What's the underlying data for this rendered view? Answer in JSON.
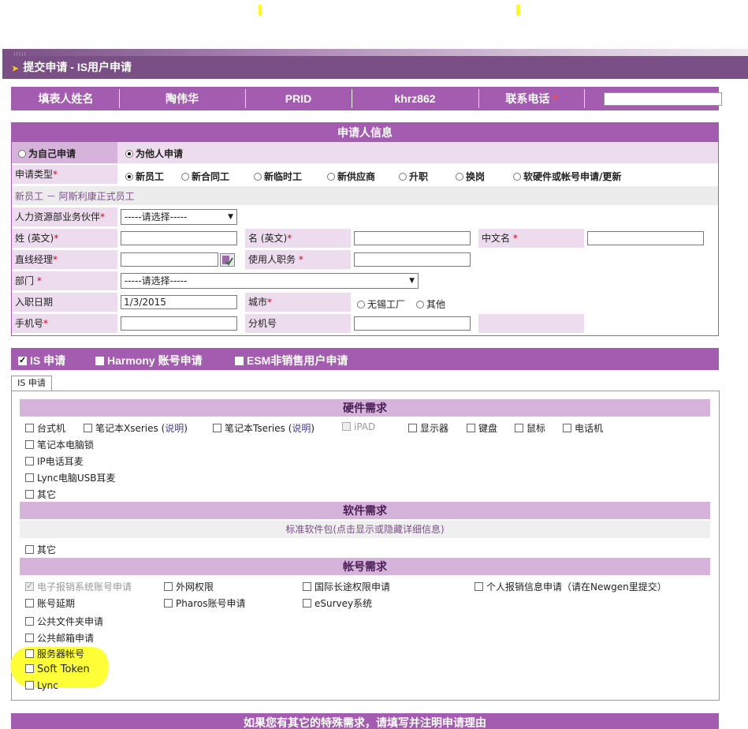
{
  "page": {
    "title": "提交申请  - IS用户申请",
    "arrow_glyph": "➤"
  },
  "filler": {
    "name_label": "填表人姓名",
    "name_value": "陶伟华",
    "prid_label": "PRID",
    "prid_value": "khrz862",
    "phone_label": "联系电话",
    "phone_value": "",
    "required_mark": "*"
  },
  "applicant": {
    "header": "申请人信息",
    "self_label": "为自己申请",
    "other_label": "为他人申请",
    "type_label": "申请类型",
    "types": [
      "新员工",
      "新合同工",
      "新临时工",
      "新供应商",
      "升职",
      "换岗",
      "软硬件或帐号申请/更新"
    ],
    "selected_type": "新员工",
    "type_desc": "新员工 － 阿斯利康正式员工",
    "hr_label": "人力资源部业务伙伴",
    "hr_value": "-----请选择-----",
    "surname_label": "姓 (英文)",
    "surname_value": "",
    "given_label": "名 (英文)",
    "given_value": "",
    "cn_name_label": "中文名",
    "cn_name_value": "",
    "manager_label": "直线经理",
    "manager_value": "",
    "position_label": "使用人职务",
    "position_value": "",
    "dept_label": "部门",
    "dept_value": "-----请选择-----",
    "join_label": "入职日期",
    "join_value": "1/3/2015",
    "city_label": "城市",
    "city_opt1": "无锡工厂",
    "city_opt2": "其他",
    "mobile_label": "手机号",
    "mobile_value": "",
    "ext_label": "分机号",
    "ext_value": ""
  },
  "tabs": {
    "is_label": "IS 申请",
    "harmony_label": "Harmony 账号申请",
    "esm_label": "ESM非销售用户申请",
    "active_tab": "IS 申请"
  },
  "hardware": {
    "header": "硬件需求",
    "desktop": "台式机",
    "notebook_x": "笔记本Xseries",
    "notebook_t": "笔记本Tseries",
    "explain": "说明",
    "ipad": "iPAD",
    "monitor": "显示器",
    "keyboard": "键盘",
    "mouse": "鼠标",
    "phone": "电话机",
    "lock": "笔记本电脑锁",
    "ip_headset": "IP电话耳麦",
    "lync_headset": "Lync电脑USB耳麦",
    "other": "其它"
  },
  "software": {
    "header": "软件需求",
    "standard_link": "标准软件包(点击显示或隐藏详细信息)",
    "other": "其它"
  },
  "account": {
    "header": "帐号需求",
    "expense": "电子报销系统账号申请",
    "internet": "外网权限",
    "intl_call": "国际长途权限申请",
    "personal_expense": "个人报销信息申请（请在Newgen里提交）",
    "extend": "账号延期",
    "pharos": "Pharos账号申请",
    "esurvey": "eSurvey系统",
    "public_folder": "公共文件夹申请",
    "public_mail": "公共邮箱申请",
    "server_account": "服务器帐号",
    "soft_token": "Soft Token",
    "lync": "Lync"
  },
  "footer": {
    "notice": "如果您有其它的特殊需求，请填写并注明申请理由"
  },
  "colors": {
    "primary": "#a45cb0",
    "dark": "#7a4f86",
    "label_bg": "#ecdced",
    "highlight": "#ffff38"
  }
}
